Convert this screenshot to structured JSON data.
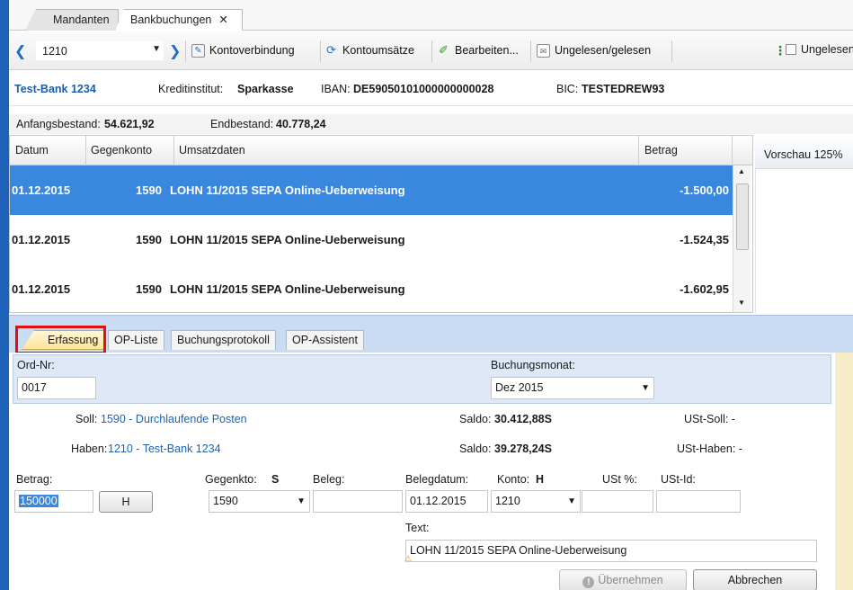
{
  "top_tabs": [
    {
      "label": "Mandanten"
    },
    {
      "label": "Bankbuchungen",
      "close": "✕"
    }
  ],
  "toolbar": {
    "account_value": "1210",
    "buttons": [
      {
        "label": "Kontoverbindung",
        "icon": "edit-icon"
      },
      {
        "label": "Kontoumsätze",
        "icon": "refresh-icon"
      },
      {
        "label": "Bearbeiten...",
        "icon": "pen-icon"
      },
      {
        "label": "Ungelesen/gelesen",
        "icon": "envelope-icon"
      }
    ],
    "right_checkbox_label": "Ungelesen"
  },
  "info": {
    "bank_name": "Test-Bank 1234",
    "institute_label": "Kreditinstitut:",
    "institute_value": "Sparkasse",
    "iban_label": "IBAN:",
    "iban_value": "DE59050101000000000028",
    "bic_label": "BIC:",
    "bic_value": "TESTEDREW93"
  },
  "balances": {
    "start_label": "Anfangsbestand:",
    "start_value": "54.621,92",
    "end_label": "Endbestand:",
    "end_value": "40.778,24"
  },
  "grid": {
    "headers": [
      "Datum",
      "Gegenkonto",
      "Umsatzdaten",
      "Betrag"
    ],
    "rows": [
      {
        "date": "01.12.2015",
        "account": "1590",
        "text": "LOHN 11/2015 SEPA Online-Ueberweisung",
        "amount": "-1.500,00",
        "selected": true
      },
      {
        "date": "01.12.2015",
        "account": "1590",
        "text": "LOHN  11/2015 SEPA Online-Ueberweisung",
        "amount": "-1.524,35",
        "selected": false
      },
      {
        "date": "01.12.2015",
        "account": "1590",
        "text": "LOHN 11/2015 SEPA Online-Ueberweisung",
        "amount": "-1.602,95",
        "selected": false
      }
    ]
  },
  "preview": {
    "label": "Vorschau 125%"
  },
  "sub_tabs": [
    "Erfassung",
    "OP-Liste",
    "Buchungsprotokoll",
    "OP-Assistent"
  ],
  "form": {
    "ord_label": "Ord-Nr:",
    "ord_value": "0017",
    "month_label": "Buchungsmonat:",
    "month_value": "Dez 2015",
    "soll_label": "Soll:",
    "soll_link": "1590 - Durchlaufende Posten",
    "saldo_label": "Saldo:",
    "saldo_soll_value": "30.412,88S",
    "ust_soll_label": "USt-Soll: -",
    "haben_label": "Haben:",
    "haben_link": "1210 - Test-Bank 1234",
    "saldo_haben_value": "39.278,24S",
    "ust_haben_label": "USt-Haben: -",
    "betrag_label": "Betrag:",
    "betrag_value": "150000",
    "h_button": "H",
    "gegenkto_label": "Gegenkto:",
    "gegenkto_side": "S",
    "gegenkto_value": "1590",
    "beleg_label": "Beleg:",
    "beleg_value": "",
    "belegdatum_label": "Belegdatum:",
    "belegdatum_value": "01.12.2015",
    "konto_label": "Konto:",
    "konto_side": "H",
    "konto_value": "1210",
    "ust_pct_label": "USt %:",
    "ust_id_label": "USt-Id:",
    "text_label": "Text:",
    "text_value": "LOHN 11/2015 SEPA Online-Ueberweisung",
    "accept_button": "Übernehmen",
    "cancel_button": "Abbrechen"
  },
  "colors": {
    "frame": "#1d62b8",
    "selection": "#3a87e0",
    "link": "#1c63b4",
    "highlight_box": "#e01010"
  }
}
